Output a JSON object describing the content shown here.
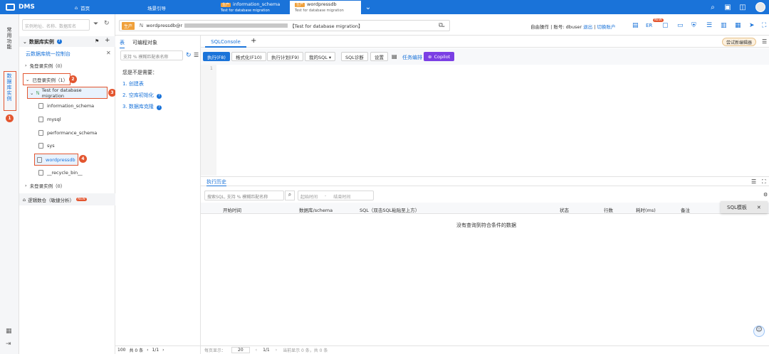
{
  "topbar": {
    "brand": "DMS",
    "tabs": [
      {
        "label": "首页"
      },
      {
        "label": "场景引导"
      },
      {
        "label": "information_schema",
        "env": "生产",
        "sub": "Test for database migration"
      },
      {
        "label": "wordpressdb",
        "env": "生产",
        "sub": "Test for database migration"
      }
    ]
  },
  "rail": {
    "top": "常用功能",
    "active": "数据库实例"
  },
  "sidebar": {
    "search_placeholder": "实例地址、名称、数据库名",
    "section_title": "数据库实例",
    "console_link": "云数据库统一控制台",
    "free_login": "免登录实例（0）",
    "logged_in": "已登录实例（1）",
    "instance": "Test for database migration",
    "databases": [
      "information_schema",
      "mysql",
      "performance_schema",
      "sys",
      "wordpressdb",
      "__recycle_bin__"
    ],
    "not_logged": "未登录实例（0）",
    "logic": "逻辑数仓（敏捷分析）",
    "logic_badge": "NEW",
    "annotations": [
      "1",
      "2",
      "3",
      "4"
    ]
  },
  "conn": {
    "env": "生产",
    "db": "wordpressdb@r",
    "instance": "【Test for database migration】"
  },
  "user": {
    "text": "自由操作 | 账号: dbuser",
    "logout": "退出",
    "switch": "切换账户",
    "er": "ER",
    "new_badge": "NEW"
  },
  "midpanel": {
    "tab1": "表",
    "tab2": "可编程对象",
    "filter_placeholder": "支持 % 模糊匹配表名称",
    "hint": "您是不是需要：",
    "items": [
      "1. 创建表",
      "2. 空库初始化",
      "3. 数据库克隆"
    ]
  },
  "console": {
    "tab": "SQLConsole",
    "try_new": "尝试新编辑器",
    "buttons": [
      "执行(F8)",
      "格式化(F10)",
      "执行计划(F9)",
      "我的SQL ▾",
      "SQL诊断",
      "设置"
    ],
    "task": "任务编排",
    "copilot": "Copilot",
    "line": "1"
  },
  "history": {
    "title": "执行历史",
    "search_placeholder": "搜索SQL, 支持 % 模糊匹配名称",
    "start": "起始时间",
    "end": "结束时间",
    "columns": [
      "开始时间",
      "数据库/schema",
      "SQL（双击SQL粘贴至上方）",
      "状态",
      "行数",
      "耗时(ms)",
      "备注"
    ],
    "empty": "没有查询到符合条件的数据",
    "sql_tpl": "SQL模板"
  },
  "footer": {
    "page_size": "100",
    "total": "共 0 条",
    "page": "1/1",
    "rows_label": "每页显示：",
    "rows": "20",
    "count": "当前显示 0 条，共 0 条"
  },
  "colors": {
    "primary": "#1a73d9",
    "annotation": "#e35630",
    "env": "#f0a03a"
  }
}
